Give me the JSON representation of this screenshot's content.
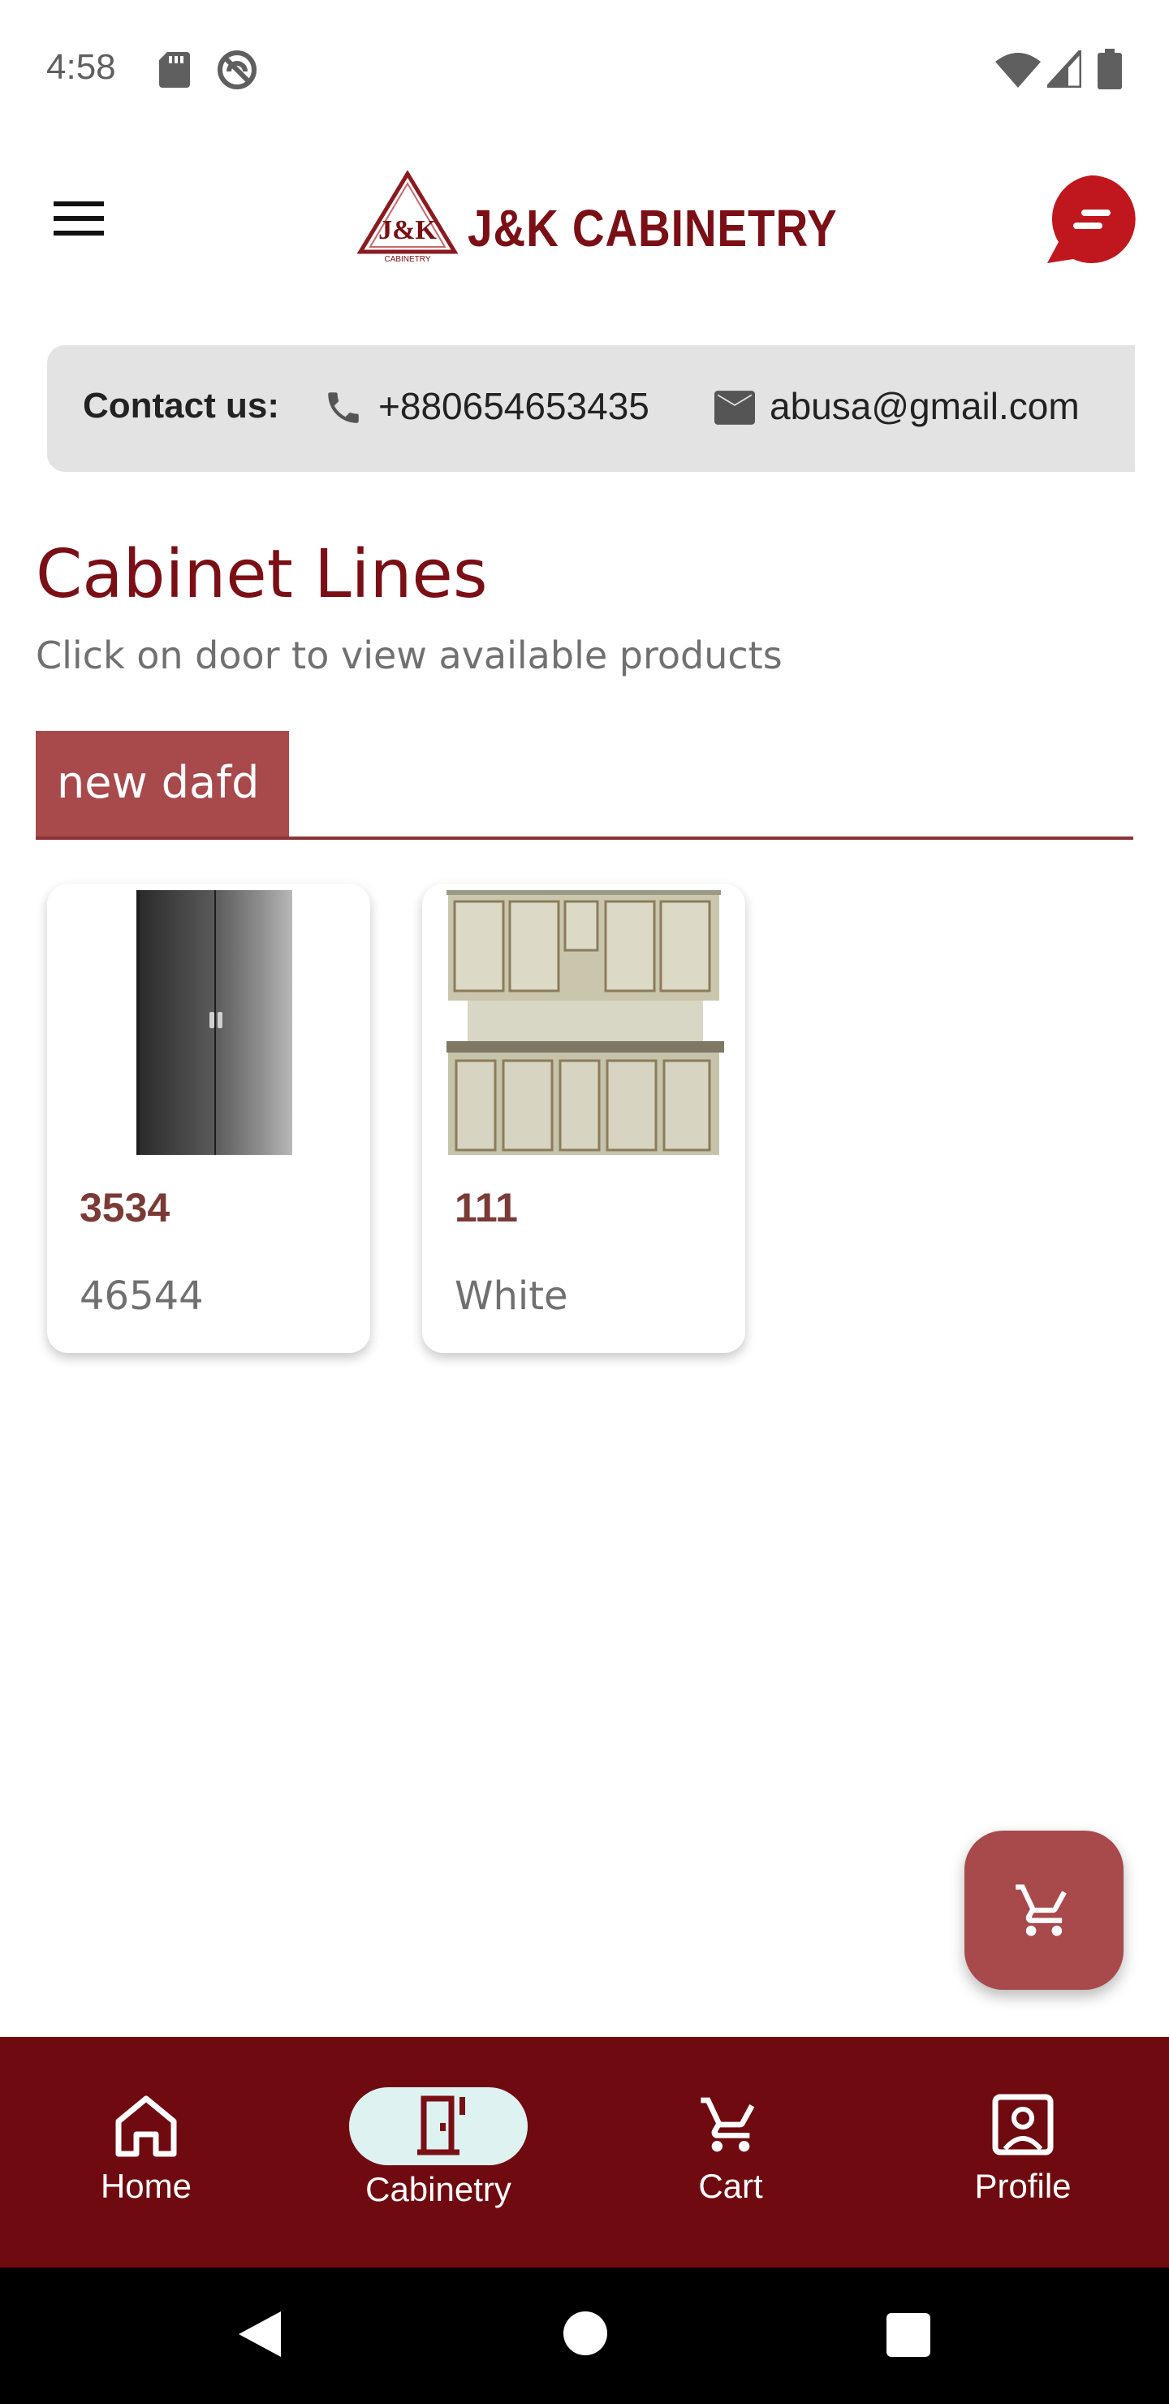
{
  "status_bar": {
    "time": "4:58"
  },
  "app_bar": {
    "brand_name": "J&K CABINETRY",
    "logo_mark_text": "J&K",
    "logo_mark_sub": "CABINETRY"
  },
  "contact": {
    "label": "Contact us:",
    "phone": "+880654653435",
    "email": "abusa@gmail.com"
  },
  "page": {
    "title": "Cabinet Lines",
    "subtitle": "Click on door to view available products"
  },
  "tabs": [
    {
      "label": "new dafd",
      "active": true
    }
  ],
  "products": [
    {
      "code": "3534",
      "color": "46544",
      "image": "grey-metal-cabinet"
    },
    {
      "code": "111",
      "color": "White",
      "image": "antique-painted-hutch"
    }
  ],
  "bottom_nav": {
    "items": [
      {
        "label": "Home",
        "icon": "home-icon",
        "active": false
      },
      {
        "label": "Cabinetry",
        "icon": "door-icon",
        "active": true
      },
      {
        "label": "Cart",
        "icon": "cart-icon",
        "active": false
      },
      {
        "label": "Profile",
        "icon": "profile-icon",
        "active": false
      }
    ]
  },
  "colors": {
    "brand": "#7a0f15",
    "accent": "#a8494c",
    "nav_bg": "#6f0b10",
    "active_pill": "#dff2f2"
  }
}
